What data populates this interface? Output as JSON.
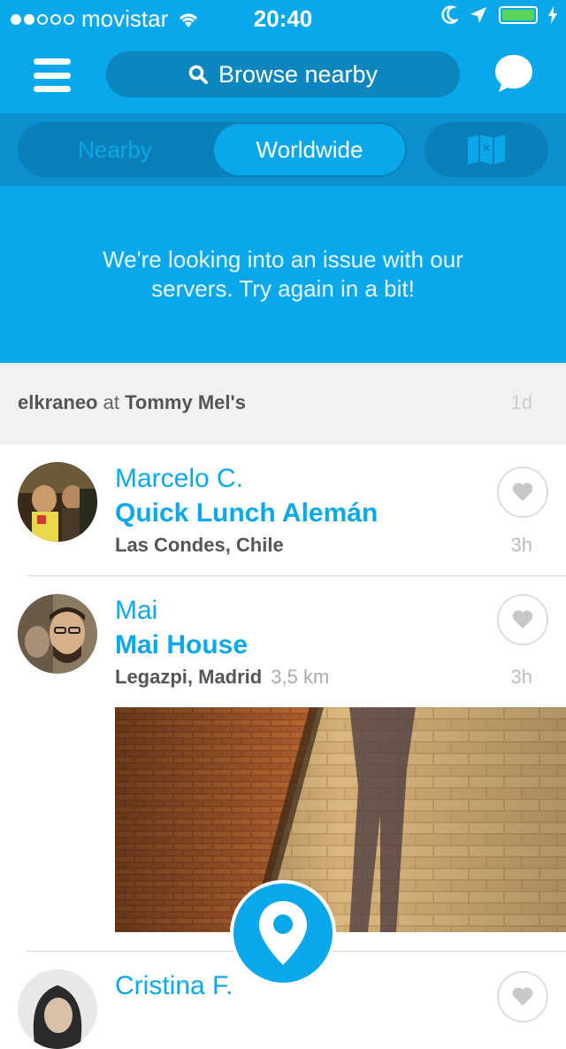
{
  "status_bar": {
    "carrier": "movistar",
    "time": "20:40"
  },
  "nav": {
    "search_label": "Browse nearby",
    "menu_icon": "hamburger-menu-icon",
    "chat_icon": "chat-bubble-icon"
  },
  "segments": {
    "nearby": "Nearby",
    "worldwide": "Worldwide",
    "selected": "Worldwide",
    "map_icon": "map-icon"
  },
  "banner": {
    "message": "We're looking into an issue with our servers. Try again in a bit!"
  },
  "activity": {
    "user": "elkraneo",
    "at": "at",
    "venue": "Tommy Mel's",
    "age": "1d"
  },
  "feed": [
    {
      "name": "Marcelo C.",
      "place": "Quick Lunch Alemán",
      "location": "Las Condes, Chile",
      "distance": "",
      "age": "3h"
    },
    {
      "name": "Mai",
      "place": "Mai House",
      "location": "Legazpi, Madrid",
      "distance": "3,5 km",
      "age": "3h"
    },
    {
      "name": "Cristina F.",
      "place": "",
      "location": "",
      "distance": "",
      "age": ""
    }
  ],
  "colors": {
    "brand": "#0aa8ea",
    "brand_dark": "#0a7fb8"
  }
}
